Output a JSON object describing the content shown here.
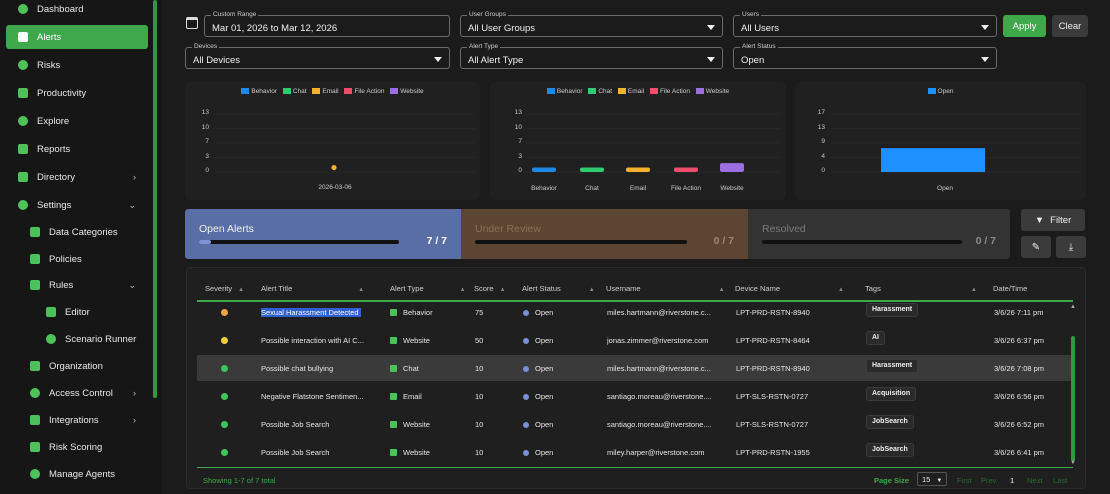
{
  "sidebar": {
    "items": [
      {
        "label": "Dashboard",
        "icon": "shield-icon"
      },
      {
        "label": "Alerts",
        "icon": "bell-icon",
        "active": true
      },
      {
        "label": "Risks",
        "icon": "shield-icon"
      },
      {
        "label": "Productivity",
        "icon": "bar-icon"
      },
      {
        "label": "Explore",
        "icon": "search-icon"
      },
      {
        "label": "Reports",
        "icon": "report-icon"
      },
      {
        "label": "Directory",
        "icon": "list-icon"
      },
      {
        "label": "Settings",
        "icon": "gear-icon"
      },
      {
        "label": "Data Categories",
        "icon": "grid-icon"
      },
      {
        "label": "Policies",
        "icon": "doc-icon"
      },
      {
        "label": "Rules",
        "icon": "rules-icon"
      },
      {
        "label": "Editor",
        "icon": "puzzle-icon"
      },
      {
        "label": "Scenario Runner",
        "icon": "runner-icon"
      },
      {
        "label": "Organization",
        "icon": "org-icon"
      },
      {
        "label": "Access Control",
        "icon": "key-icon"
      },
      {
        "label": "Integrations",
        "icon": "plug-icon"
      },
      {
        "label": "Risk Scoring",
        "icon": "chart-icon"
      },
      {
        "label": "Manage Agents",
        "icon": "agent-icon"
      }
    ]
  },
  "filters": {
    "range": {
      "label": "Custom Range",
      "value": "Mar 01, 2026 to Mar 12, 2026"
    },
    "user_groups": {
      "label": "User Groups",
      "value": "All User Groups"
    },
    "users": {
      "label": "Users",
      "value": "All Users"
    },
    "devices": {
      "label": "Devices",
      "value": "All Devices"
    },
    "alert_type": {
      "label": "Alert Type",
      "value": "All Alert Type"
    },
    "alert_status": {
      "label": "Alert Status",
      "value": "Open"
    },
    "apply": "Apply",
    "clear": "Clear"
  },
  "colors": {
    "behavior": "#1e88e5",
    "chat": "#2ecc71",
    "email": "#f5b02e",
    "file_action": "#ef4d6c",
    "website": "#9b6fe0",
    "open": "#1e90ff",
    "accent": "#3ea84a"
  },
  "legend": {
    "behavior": "Behavior",
    "chat": "Chat",
    "email": "Email",
    "file_action": "File Action",
    "website": "Website",
    "open": "Open"
  },
  "chart_data": [
    {
      "type": "scatter",
      "series": [
        {
          "name": "Email",
          "x": [
            "2026-03-06"
          ],
          "y": [
            1
          ]
        }
      ],
      "x": [
        "2026-03-06"
      ],
      "yticks": [
        "0",
        "3",
        "7",
        "10",
        "13"
      ],
      "ylim": [
        0,
        13
      ],
      "legend": [
        "Behavior",
        "Chat",
        "Email",
        "File Action",
        "Website"
      ],
      "legend_position": "top"
    },
    {
      "type": "bar",
      "categories": [
        "Behavior",
        "Chat",
        "Email",
        "File Action",
        "Website"
      ],
      "values": [
        1,
        1,
        1,
        1,
        2
      ],
      "yticks": [
        "0",
        "3",
        "7",
        "10",
        "13"
      ],
      "ylim": [
        0,
        13
      ],
      "legend": [
        "Behavior",
        "Chat",
        "Email",
        "File Action",
        "Website"
      ],
      "legend_position": "top"
    },
    {
      "type": "bar",
      "categories": [
        "Open"
      ],
      "values": [
        7
      ],
      "yticks": [
        "0",
        "4",
        "9",
        "13",
        "17"
      ],
      "ylim": [
        0,
        17
      ],
      "legend": [
        "Open"
      ],
      "legend_position": "top"
    }
  ],
  "status": {
    "open": {
      "title": "Open Alerts",
      "count": "7 / 7",
      "progress": 0.06
    },
    "review": {
      "title": "Under Review",
      "count": "0 / 7",
      "progress": 0
    },
    "resolved": {
      "title": "Resolved",
      "count": "0 / 7",
      "progress": 0
    }
  },
  "toolbar": {
    "filter": "Filter",
    "edit_icon": "edit-icon",
    "download_icon": "download-icon"
  },
  "table": {
    "columns": [
      "Severity",
      "Alert Title",
      "Alert Type",
      "Score",
      "Alert Status",
      "Username",
      "Device Name",
      "Tags",
      "Date/Time"
    ],
    "rows": [
      {
        "severity": "#f5a04a",
        "title": "Sexual Harassment Detected",
        "type": "Behavior",
        "score": "75",
        "status": "Open",
        "user": "miles.hartmann@riverstone.c...",
        "device": "LPT-PRD-RSTN-8940",
        "tag": "Harassment",
        "date": "3/6/26 7:11 pm"
      },
      {
        "severity": "#f0d040",
        "title": "Possible interaction with AI C...",
        "type": "Website",
        "score": "50",
        "status": "Open",
        "user": "jonas.zimmer@riverstone.com",
        "device": "LPT-PRD-RSTN-8464",
        "tag": "AI",
        "date": "3/6/26 6:37 pm"
      },
      {
        "severity": "#3fc65a",
        "title": "Possible chat bullying",
        "type": "Chat",
        "score": "10",
        "status": "Open",
        "user": "miles.hartmann@riverstone.c...",
        "device": "LPT-PRD-RSTN-8940",
        "tag": "Harassment",
        "date": "3/6/26 7:08 pm"
      },
      {
        "severity": "#3fc65a",
        "title": "Negative Flatstone Sentimen...",
        "type": "Email",
        "score": "10",
        "status": "Open",
        "user": "santiago.moreau@riverstone....",
        "device": "LPT-SLS-RSTN-0727",
        "tag": "Acquisition",
        "date": "3/6/26 6:56 pm"
      },
      {
        "severity": "#3fc65a",
        "title": "Possible Job Search",
        "type": "Website",
        "score": "10",
        "status": "Open",
        "user": "santiago.moreau@riverstone....",
        "device": "LPT-SLS-RSTN-0727",
        "tag": "JobSearch",
        "date": "3/6/26 6:52 pm"
      },
      {
        "severity": "#3fc65a",
        "title": "Possible Job Search",
        "type": "Website",
        "score": "10",
        "status": "Open",
        "user": "miley.harper@riverstone.com",
        "device": "LPT-PRD-RSTN-1955",
        "tag": "JobSearch",
        "date": "3/6/26 6:41 pm"
      }
    ]
  },
  "footer": {
    "showing": "Showing 1-7 of 7 total",
    "page_size_label": "Page Size",
    "page_size": "15",
    "first": "First",
    "prev": "Prev",
    "page": "1",
    "next": "Next",
    "last": "Last"
  }
}
